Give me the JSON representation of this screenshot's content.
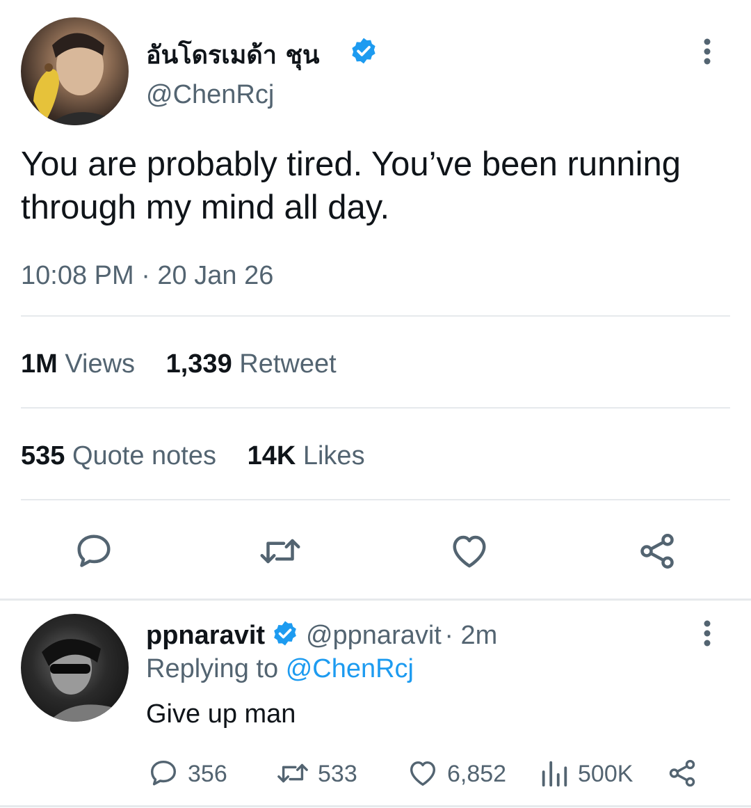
{
  "tweet": {
    "author_name": "อันโดรเมด้า ชุน",
    "author_handle": "@ChenRcj",
    "text_line1": "You are probably tired. You’ve been running",
    "text_line2": "through my mind all day.",
    "timestamp": "10:08 PM · 20 Jan 26",
    "stats": {
      "views_count": "1M",
      "views_label": "Views",
      "retweet_count": "1,339",
      "retweet_label": "Retweet",
      "quote_count": "535",
      "quote_label": "Quote notes",
      "likes_count": "14K",
      "likes_label": "Likes"
    }
  },
  "reply": {
    "author_name": "ppnaravit",
    "author_handle": "@ppnaravit",
    "time": "· 2m",
    "replying_to_label": "Replying to",
    "replying_to_handle": "@ChenRcj",
    "text": "Give up man",
    "counts": {
      "replies": "356",
      "retweets": "533",
      "likes": "6,852",
      "views": "500K"
    }
  },
  "colors": {
    "verified": "#1d9bf0",
    "link": "#1d9bf0",
    "muted": "#536471",
    "text": "#0f1419"
  },
  "icons": [
    "verified-badge-icon",
    "more-icon",
    "reply-icon",
    "retweet-icon",
    "like-icon",
    "share-icon",
    "views-icon"
  ]
}
